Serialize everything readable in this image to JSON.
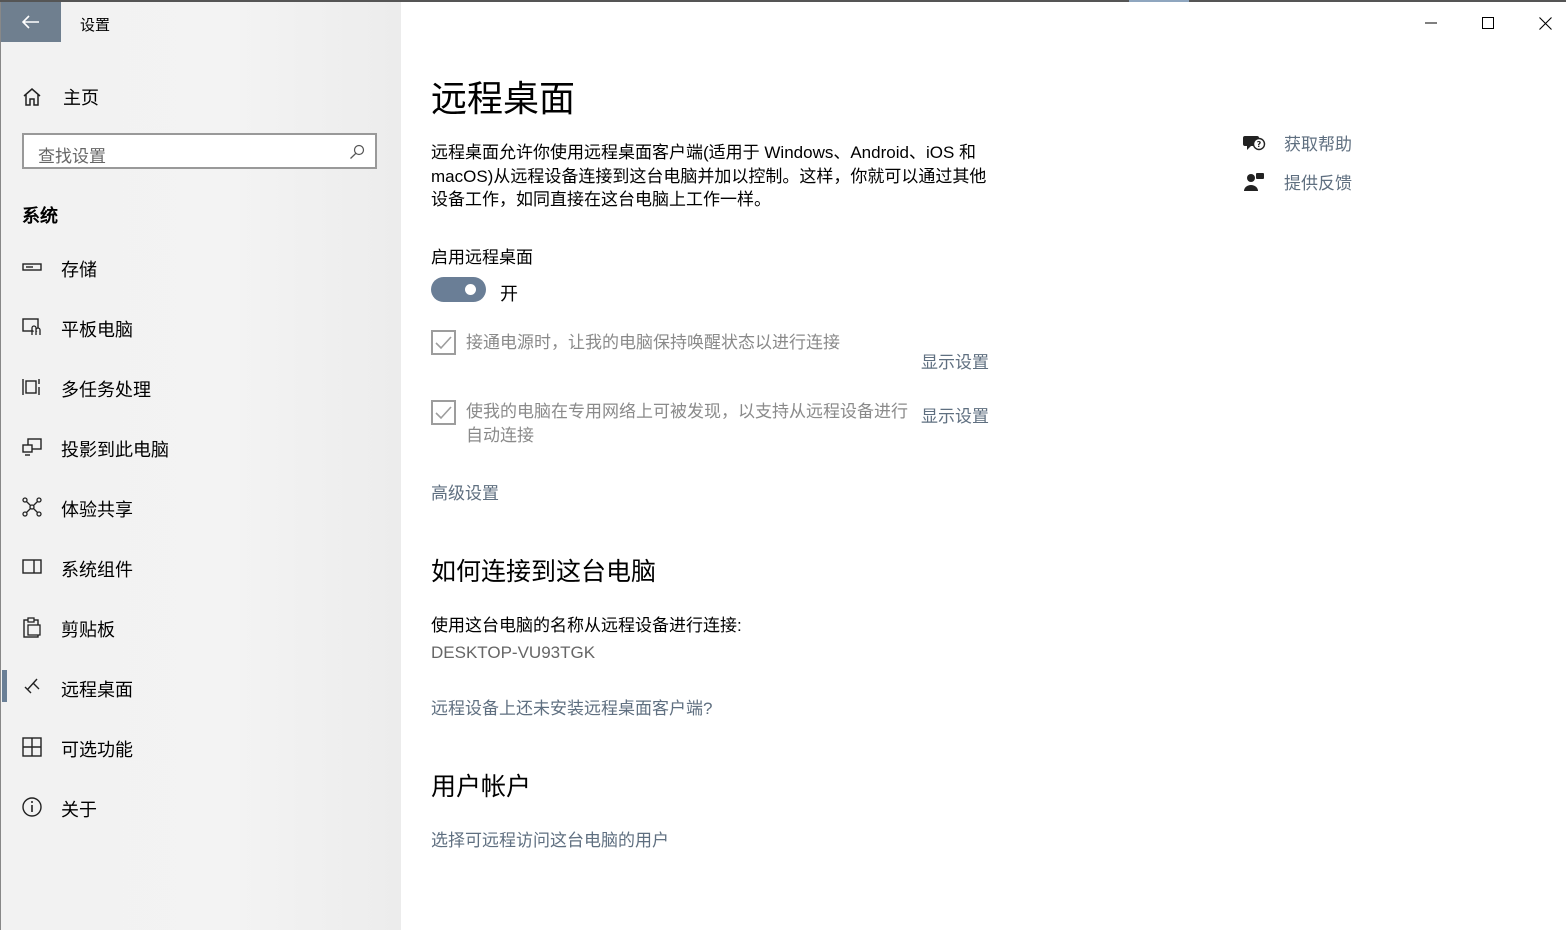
{
  "window": {
    "app_title": "设置",
    "minimize_glyph": "─",
    "maximize_glyph": "☐",
    "close_glyph": "✕"
  },
  "sidebar": {
    "home_label": "主页",
    "search_placeholder": "查找设置",
    "section_title": "系统",
    "items": [
      {
        "label": "存储",
        "icon": "storage-icon"
      },
      {
        "label": "平板电脑",
        "icon": "tablet-icon"
      },
      {
        "label": "多任务处理",
        "icon": "multitasking-icon"
      },
      {
        "label": "投影到此电脑",
        "icon": "projecting-icon"
      },
      {
        "label": "体验共享",
        "icon": "shared-experiences-icon"
      },
      {
        "label": "系统组件",
        "icon": "system-components-icon"
      },
      {
        "label": "剪贴板",
        "icon": "clipboard-icon"
      },
      {
        "label": "远程桌面",
        "icon": "remote-desktop-icon",
        "active": true
      },
      {
        "label": "可选功能",
        "icon": "optional-features-icon"
      },
      {
        "label": "关于",
        "icon": "about-icon"
      }
    ]
  },
  "main": {
    "title": "远程桌面",
    "description": "远程桌面允许你使用远程桌面客户端(适用于 Windows、Android、iOS 和 macOS)从远程设备连接到这台电脑并加以控制。这样，你就可以通过其他设备工作，如同直接在这台电脑上工作一样。",
    "enable_label": "启用远程桌面",
    "toggle_state": "开",
    "toggle_on": true,
    "options": [
      {
        "text": "接通电源时，让我的电脑保持唤醒状态以进行连接",
        "link": "显示设置",
        "checked": true
      },
      {
        "text": "使我的电脑在专用网络上可被发现，以支持从远程设备进行自动连接",
        "link": "显示设置",
        "checked": true
      }
    ],
    "advanced_link": "高级设置",
    "connect_heading": "如何连接到这台电脑",
    "connect_text": "使用这台电脑的名称从远程设备进行连接:",
    "pc_name": "DESKTOP-VU93TGK",
    "client_link": "远程设备上还未安装远程桌面客户端?",
    "accounts_heading": "用户帐户",
    "accounts_link": "选择可远程访问这台电脑的用户"
  },
  "help": {
    "get_help": "获取帮助",
    "feedback": "提供反馈"
  },
  "colors": {
    "accent": "#6a7e96",
    "link": "#5f6f80",
    "back_button": "#6f7f8f"
  }
}
